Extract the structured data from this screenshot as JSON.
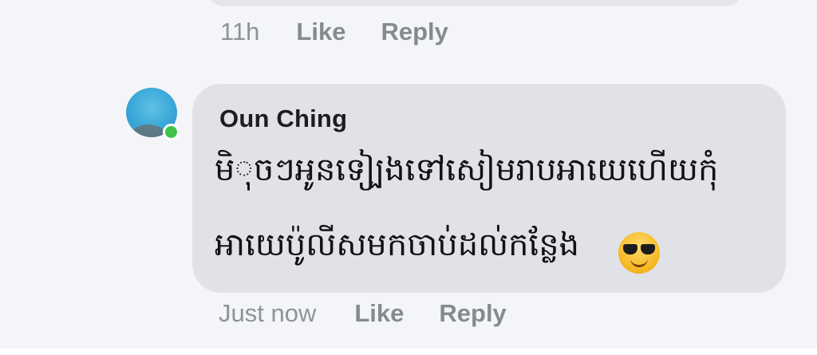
{
  "previous_comment": {
    "timestamp": "11h",
    "like_label": "Like",
    "reply_label": "Reply"
  },
  "comment": {
    "author": "Oun Ching",
    "text_line1": "មិុចៗអូនទៀ្បងទៅសៀមរាបអាយេហើយកុំ",
    "text_line2": "អាយេប៉ូលីសមកចាប់ដល់កន្លែង",
    "emoji": "smiling-face-with-sunglasses",
    "timestamp": "Just now",
    "like_label": "Like",
    "reply_label": "Reply",
    "author_online": true
  },
  "colors": {
    "bubble": "#e1e2e8",
    "background": "#f4f5f8",
    "action_text": "#868a90",
    "online": "#3ec448"
  }
}
